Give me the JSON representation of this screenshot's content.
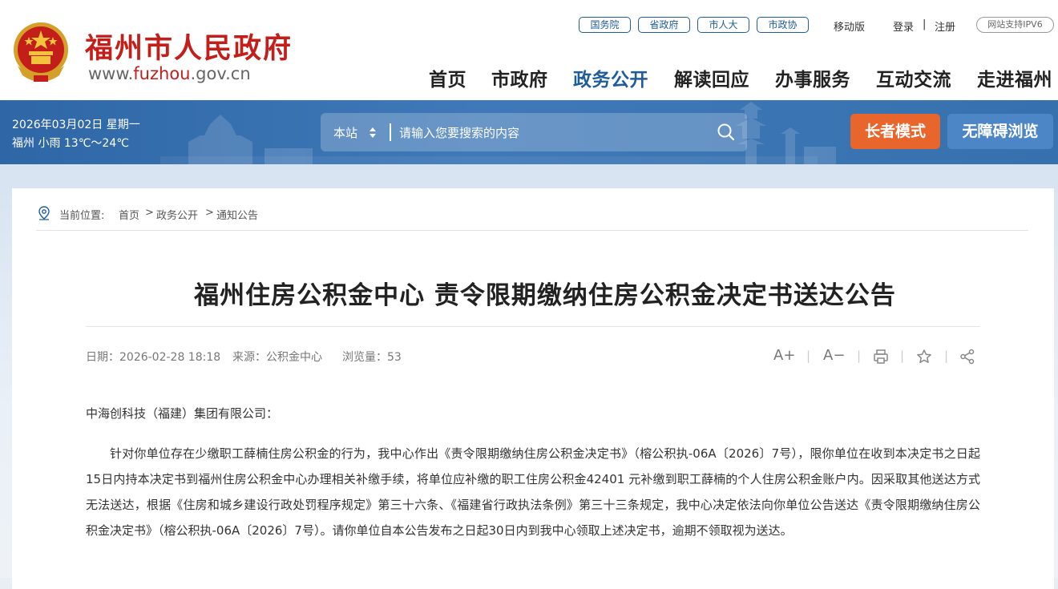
{
  "header": {
    "site_title": "福州市人民政府",
    "site_url_prefix": "www.",
    "site_url_highlight": "fuzhou",
    "site_url_suffix": ".gov.cn",
    "top_pills": [
      "国务院",
      "省政府",
      "市人大",
      "市政协"
    ],
    "mobile": "移动版",
    "login": "登录",
    "separator": "|",
    "register": "注册",
    "ipv6": "网站支持IPV6",
    "nav": [
      "首页",
      "市政府",
      "政务公开",
      "解读回应",
      "办事服务",
      "互动交流",
      "走进福州"
    ],
    "nav_active": "政务公开"
  },
  "banner": {
    "date": "2026年03月02日 星期一",
    "weather": "福州 小雨 13℃～24℃",
    "search_scope": "本站",
    "search_placeholder": "请输入您要搜索的内容",
    "elder_mode": "长者模式",
    "accessible": "无障碍浏览"
  },
  "breadcrumb": {
    "label": "当前位置:",
    "items": [
      "首页",
      "政务公开",
      "通知公告"
    ],
    "sep": ">"
  },
  "article": {
    "title": "福州住房公积金中心 责令限期缴纳住房公积金决定书送达公告",
    "date": "日期：2026-02-28 18:18",
    "source": "来源：公积金中心",
    "views": "浏览量：53",
    "tools": {
      "font_up": "A+",
      "font_down": "A−",
      "sep": "|"
    },
    "salutation": "中海创科技（福建）集团有限公司：",
    "body": "针对你单位存在少缴职工薛楠住房公积金的行为，我中心作出《责令限期缴纳住房公积金决定书》（榕公积执-06A〔2026〕7号），限你单位在收到本决定书之日起15日内持本决定书到福州住房公积金中心办理相关补缴手续，将单位应补缴的职工住房公积金42401 元补缴到职工薛楠的个人住房公积金账户内。因采取其他送达方式无法送达，根据《住房和城乡建设行政处罚程序规定》第三十六条、《福建省行政执法条例》第三十三条规定，我中心决定依法向你单位公告送达《责令限期缴纳住房公积金决定书》（榕公积执-06A〔2026〕7号）。请你单位自本公告发布之日起30日内到我中心领取上述决定书，逾期不领取视为送达。"
  },
  "colors": {
    "brand_red": "#c41e1b",
    "brand_blue": "#1e5c9b",
    "elder_orange": "#e8652c"
  }
}
